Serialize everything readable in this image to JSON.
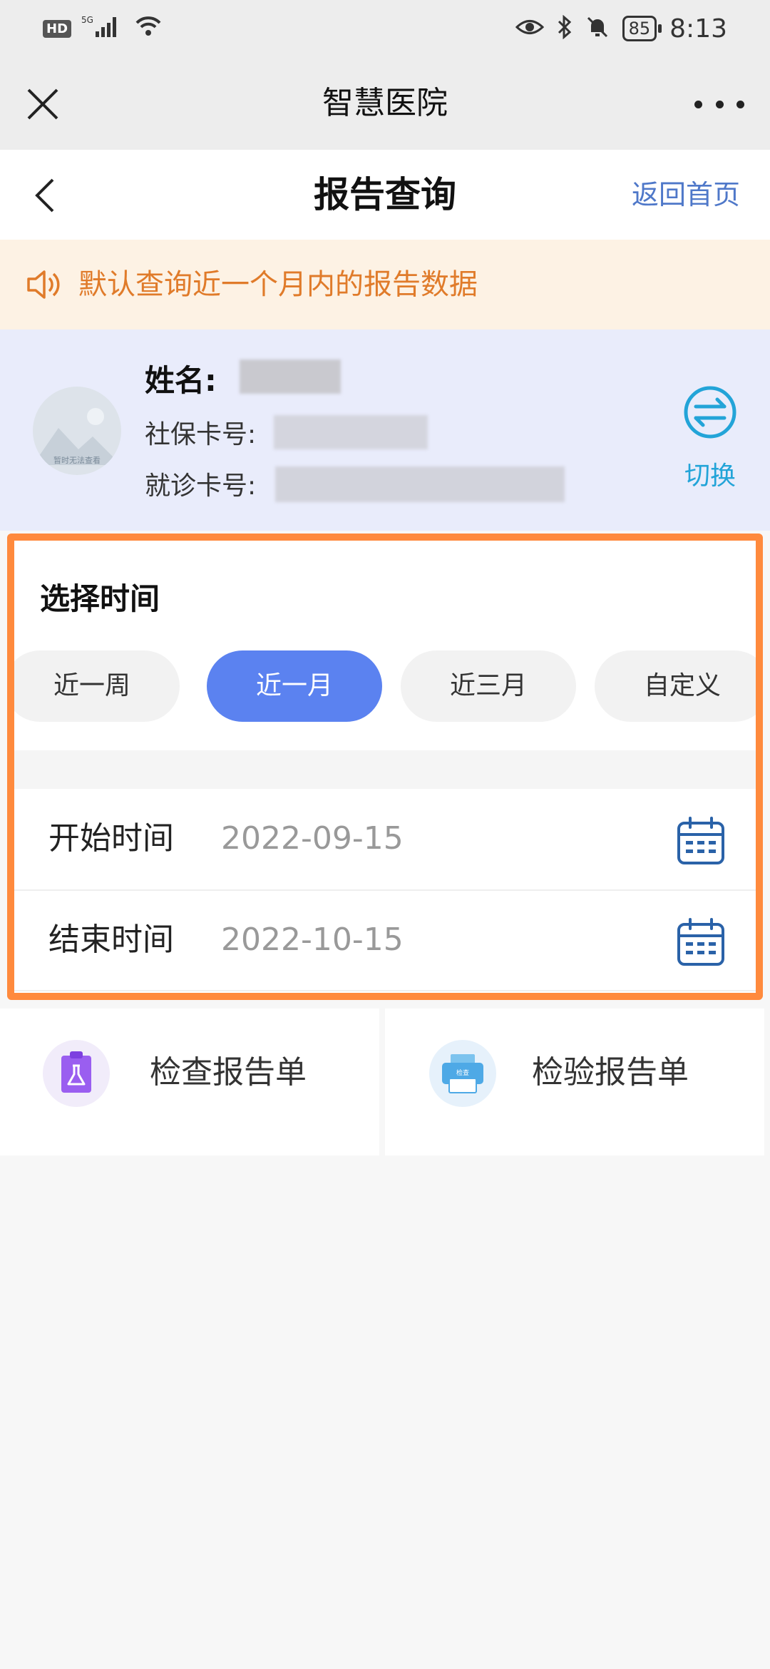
{
  "status_bar": {
    "network": "5G",
    "hd": "HD",
    "battery": "85",
    "time": "8:13"
  },
  "mini_program": {
    "title": "智慧医院"
  },
  "page": {
    "title": "报告查询",
    "home_link": "返回首页"
  },
  "notice": {
    "text": "默认查询近一个月内的报告数据"
  },
  "patient": {
    "avatar_text": "暂时无法查看",
    "name_label": "姓名:",
    "social_card_label": "社保卡号:",
    "visit_card_label": "就诊卡号:",
    "switch_label": "切换"
  },
  "time_select": {
    "title": "选择时间",
    "options": [
      "近一周",
      "近一月",
      "近三月",
      "自定义"
    ],
    "selected": "近一月",
    "start_label": "开始时间",
    "start_value": "2022-09-15",
    "end_label": "结束时间",
    "end_value": "2022-10-15"
  },
  "reports": {
    "exam_label": "检查报告单",
    "lab_label": "检验报告单",
    "lab_icon_text": "检查"
  },
  "colors": {
    "accent_blue": "#5b82f0",
    "notice_orange": "#e07b2a",
    "highlight_border": "#ff8a3d",
    "switch_cyan": "#23a4d8"
  }
}
